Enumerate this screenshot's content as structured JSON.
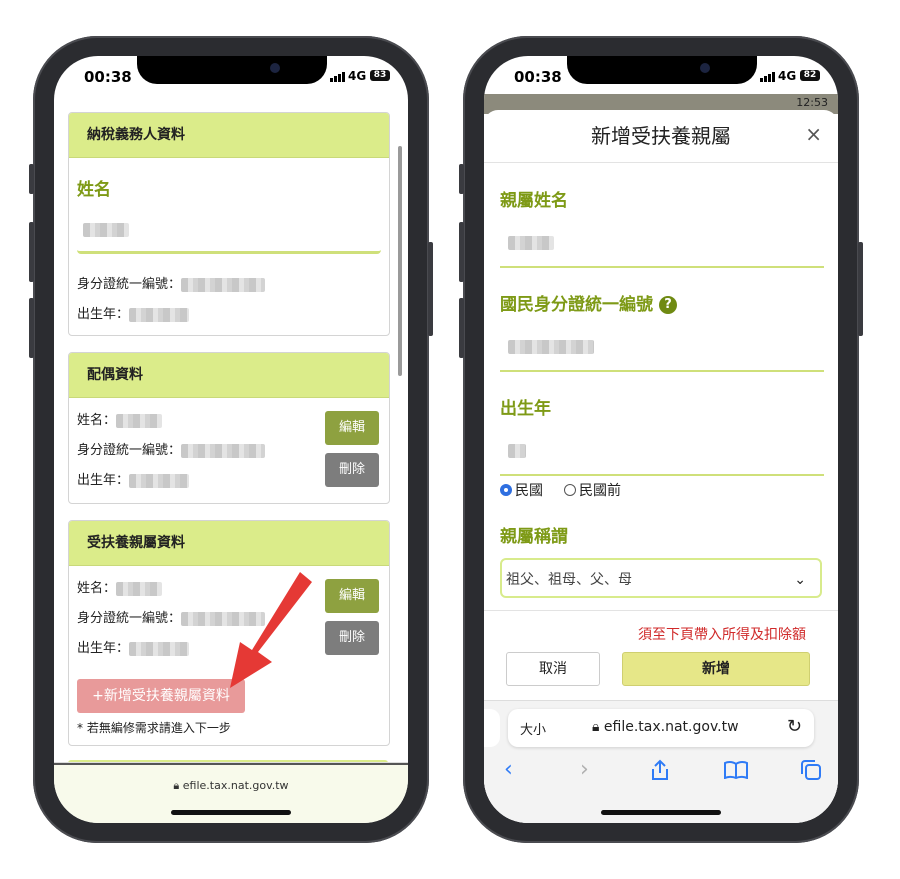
{
  "left_phone": {
    "status": {
      "time": "00:38",
      "network": "4G",
      "battery": "83"
    },
    "taxpayer": {
      "title": "納稅義務人資料",
      "name_label": "姓名",
      "id_label": "身分證統一編號：",
      "birth_label": "出生年："
    },
    "spouse": {
      "title": "配偶資料",
      "name_label": "姓名：",
      "id_label": "身分證統一編號：",
      "birth_label": "出生年：",
      "edit_label": "編輯",
      "delete_label": "刪除"
    },
    "dependents": {
      "title": "受扶養親屬資料",
      "name_label": "姓名：",
      "id_label": "身分證統一編號：",
      "birth_label": "出生年：",
      "edit_label": "編輯",
      "delete_label": "刪除",
      "add_label": "+新增受扶養親屬資料",
      "note": "* 若無編修需求請進入下一步"
    },
    "url": "efile.tax.nat.gov.tw"
  },
  "right_phone": {
    "status": {
      "time": "00:38",
      "network": "4G",
      "battery": "82"
    },
    "bg_time": "12:53",
    "modal": {
      "title": "新增受扶養親屬",
      "close": "×",
      "name_label": "親屬姓名",
      "id_label": "國民身分證統一編號",
      "help": "?",
      "birth_label": "出生年",
      "radio_roc": "民國",
      "radio_pre_roc": "民國前",
      "relation_label": "親屬稱謂",
      "relation_value": "祖父、祖母、父、母",
      "warning": "須至下頁帶入所得及扣除額",
      "cancel_label": "取消",
      "add_label": "新增"
    },
    "safari": {
      "text_size": "大小",
      "url": "efile.tax.nat.gov.tw"
    }
  },
  "colors": {
    "accent_green": "#7e9a16",
    "header_green": "#dbec8a",
    "warning_red": "#d02a2a",
    "pink_button": "#e89a9a",
    "arrow_red": "#e53935"
  }
}
